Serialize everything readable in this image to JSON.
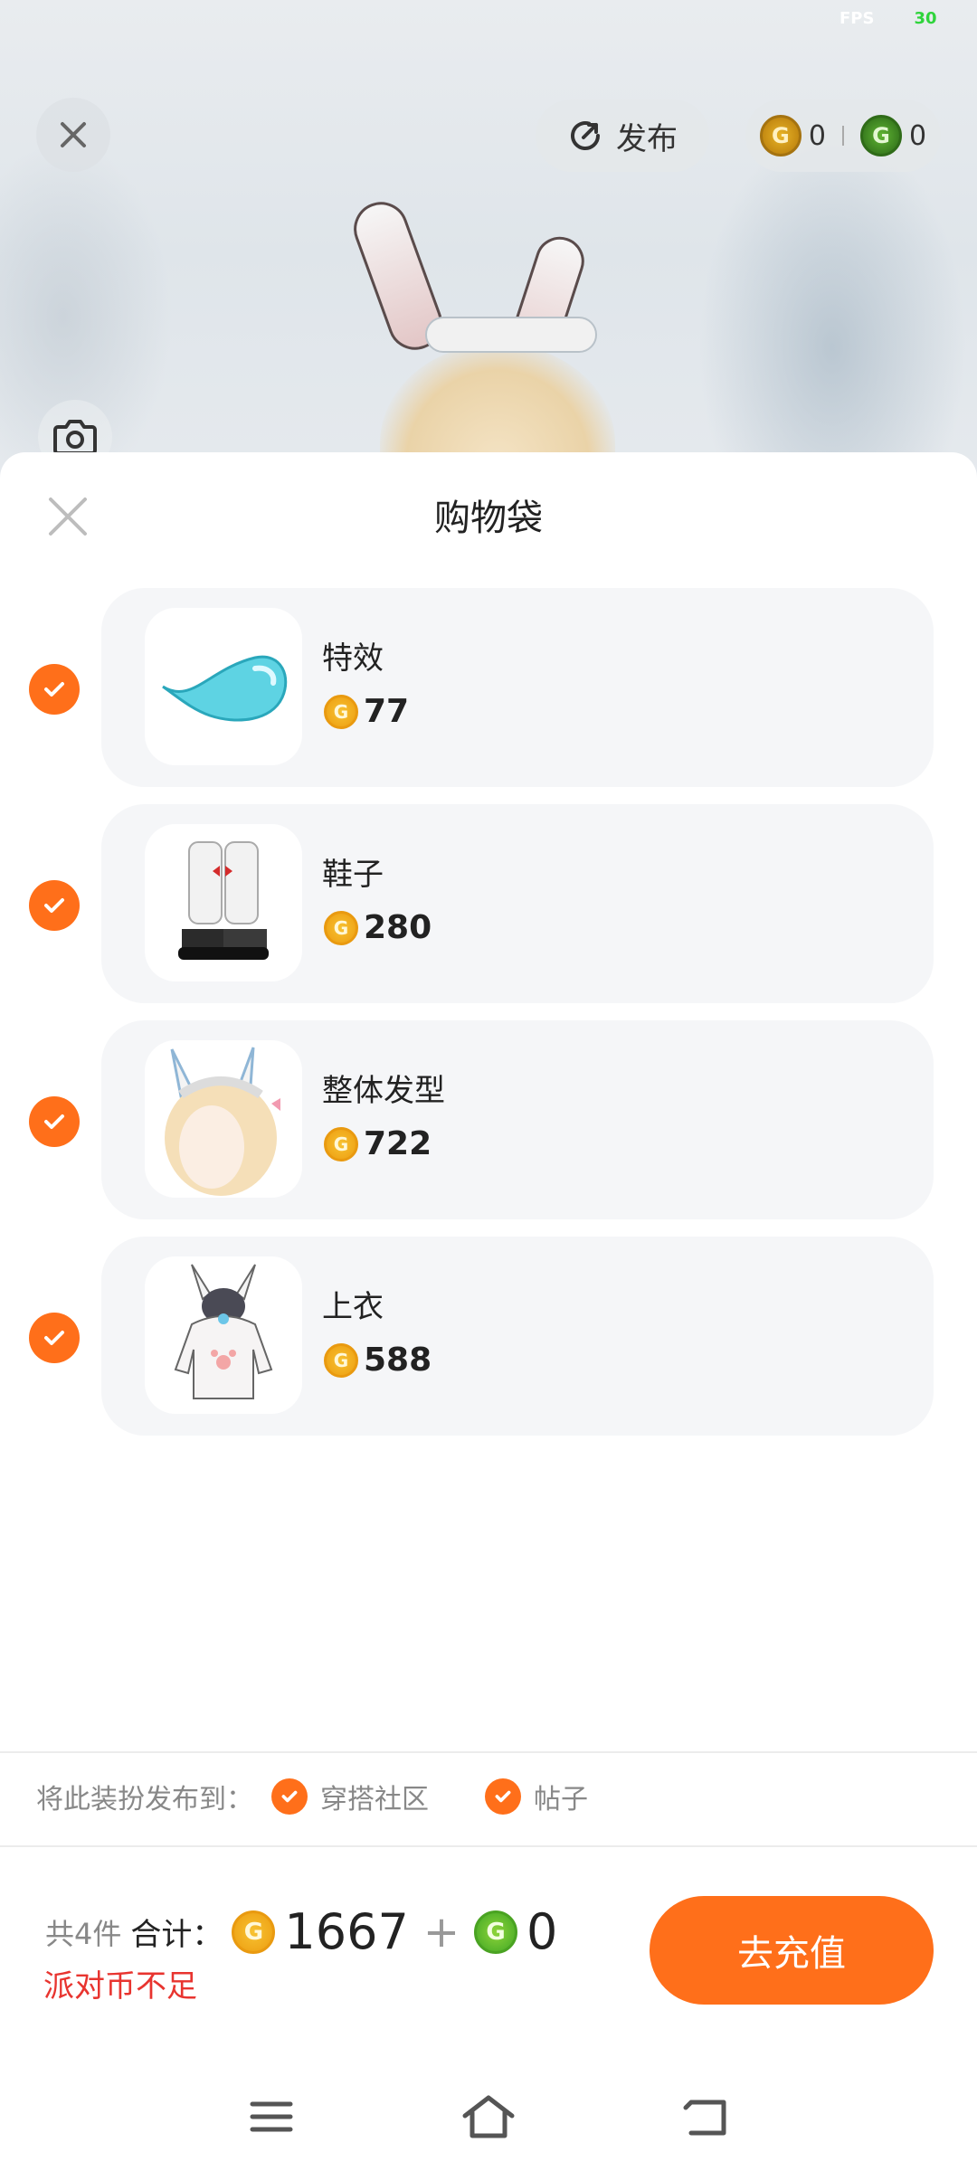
{
  "status": {
    "fps_label": "FPS",
    "fps_value": "30"
  },
  "top_bar": {
    "publish_label": "发布",
    "gold_coin_amount": "0",
    "green_coin_amount": "0"
  },
  "sheet": {
    "title": "购物袋",
    "items": [
      {
        "name": "特效",
        "price": "77",
        "checked": true
      },
      {
        "name": "鞋子",
        "price": "280",
        "checked": true
      },
      {
        "name": "整体发型",
        "price": "722",
        "checked": true
      },
      {
        "name": "上衣",
        "price": "588",
        "checked": true
      }
    ],
    "publish_to": {
      "label": "将此装扮发布到：",
      "options": [
        {
          "label": "穿搭社区",
          "checked": true
        },
        {
          "label": "帖子",
          "checked": true
        }
      ]
    },
    "total": {
      "count_text": "共4件",
      "sum_label": "合计：",
      "gold_total": "1667",
      "plus": "+",
      "green_total": "0",
      "warning": "派对币不足"
    },
    "recharge_button": "去充值"
  },
  "colors": {
    "accent": "#ff6f1a",
    "warning": "#e8342f",
    "card_bg": "#f5f6f8"
  },
  "icons": [
    "close-icon",
    "camera-icon",
    "publish-icon",
    "gold-coin-icon",
    "green-coin-icon",
    "check-icon",
    "menu-icon",
    "home-icon",
    "back-icon"
  ]
}
